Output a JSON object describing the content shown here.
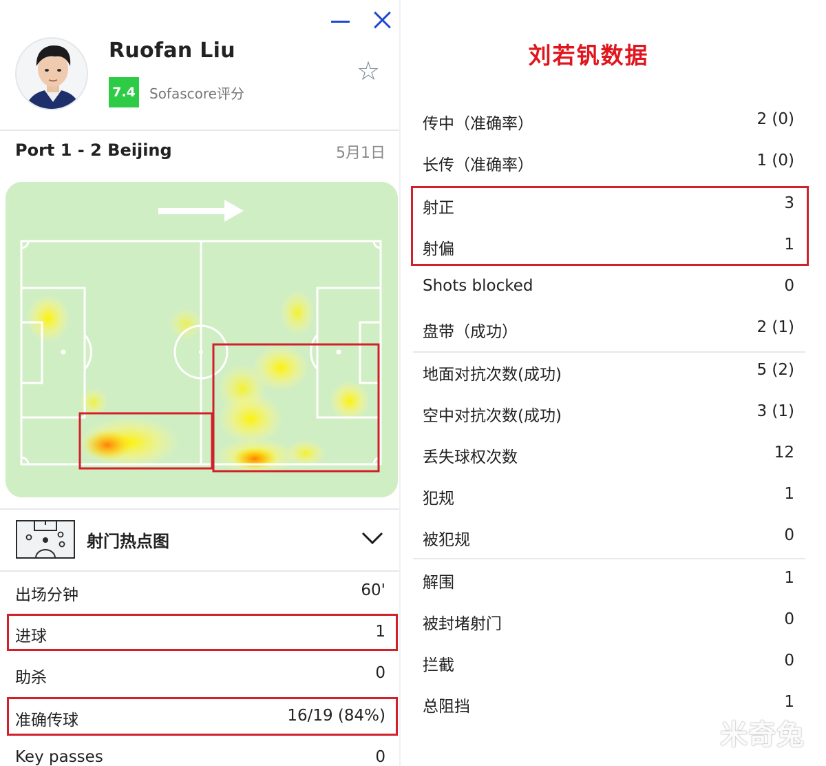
{
  "window": {
    "minimize_icon": "minimize-icon",
    "close_icon": "close-icon"
  },
  "player": {
    "name": "Ruofan Liu",
    "rating": "7.4",
    "rating_color": "#2ecc46",
    "rating_label": "Sofascore评分",
    "favorite_icon": "star-icon"
  },
  "match": {
    "score": "Port 1 - 2 Beijing",
    "date": "5月1日"
  },
  "heatmap": {
    "direction_icon": "arrow-right-icon"
  },
  "shot_map": {
    "label": "射门热点图",
    "expand_icon": "chevron-down-icon"
  },
  "left_stats": [
    {
      "label": "出场分钟",
      "value": "60'"
    },
    {
      "label": "进球",
      "value": "1"
    },
    {
      "label": "助杀",
      "value": "0"
    },
    {
      "label": "准确传球",
      "value": "16/19 (84%)"
    },
    {
      "label": "Key passes",
      "value": "0"
    }
  ],
  "right_title": "刘若钒数据",
  "right_stats": [
    {
      "label": "传中（准确率）",
      "value": "2 (0)"
    },
    {
      "label": "长传（准确率）",
      "value": "1 (0)"
    },
    {
      "label": "射正",
      "value": "3"
    },
    {
      "label": "射偏",
      "value": "1"
    },
    {
      "label": "Shots blocked",
      "value": "0"
    },
    {
      "label": "盘带（成功）",
      "value": "2 (1)"
    },
    {
      "label": "地面对抗次数(成功)",
      "value": "5 (2)"
    },
    {
      "label": "空中对抗次数(成功)",
      "value": "3 (1)"
    },
    {
      "label": "丢失球权次数",
      "value": "12"
    },
    {
      "label": "犯规",
      "value": "1"
    },
    {
      "label": "被犯规",
      "value": "0"
    },
    {
      "label": "解围",
      "value": "1"
    },
    {
      "label": "被封堵射门",
      "value": "0"
    },
    {
      "label": "拦截",
      "value": "0"
    },
    {
      "label": "总阻挡",
      "value": "1"
    }
  ],
  "highlight_color": "#d2202b",
  "watermark": "米奇兔"
}
